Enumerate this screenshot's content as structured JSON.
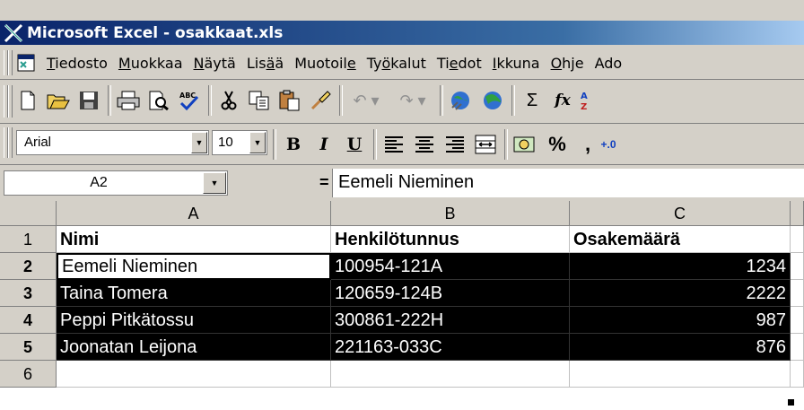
{
  "window": {
    "title": "Microsoft Excel - osakkaat.xls"
  },
  "menu": [
    "Tiedosto",
    "Muokkaa",
    "Näytä",
    "Lisää",
    "Muotoile",
    "Työkalut",
    "Tiedot",
    "Ikkuna",
    "Ohje",
    "Ado"
  ],
  "toolbar_standard": {
    "icons": [
      "new-icon",
      "open-icon",
      "save-icon",
      "print-icon",
      "print-preview-icon",
      "spelling-icon",
      "cut-icon",
      "copy-icon",
      "paste-icon",
      "format-painter-icon",
      "undo-icon",
      "redo-icon",
      "hyperlink-icon",
      "web-toolbar-icon",
      "autosum-icon",
      "function-icon",
      "sort-ascending-icon"
    ],
    "sum_label": "Σ",
    "fx_label": "fx"
  },
  "toolbar_formatting": {
    "font": "Arial",
    "size": "10",
    "bold": "B",
    "italic": "I",
    "underline": "U",
    "percent": "%",
    "comma": ","
  },
  "formula_bar": {
    "name_box": "A2",
    "equals": "=",
    "content": "Eemeli Nieminen"
  },
  "sheet": {
    "columns": [
      "A",
      "B",
      "C"
    ],
    "rows": [
      "1",
      "2",
      "3",
      "4",
      "5",
      "6"
    ],
    "data": [
      [
        "Nimi",
        "Henkilötunnus",
        "Osakemäärä"
      ],
      [
        "Eemeli Nieminen",
        "100954-121A",
        "1234"
      ],
      [
        "Taina Tomera",
        "120659-124B",
        "2222"
      ],
      [
        "Peppi Pitkätossu",
        "300861-222H",
        "987"
      ],
      [
        "Joonatan Leijona",
        "221163-033C",
        "876"
      ]
    ]
  },
  "colors": {
    "title_gradient_start": "#0a246a",
    "selection": "#000000",
    "face": "#d4d0c8"
  }
}
